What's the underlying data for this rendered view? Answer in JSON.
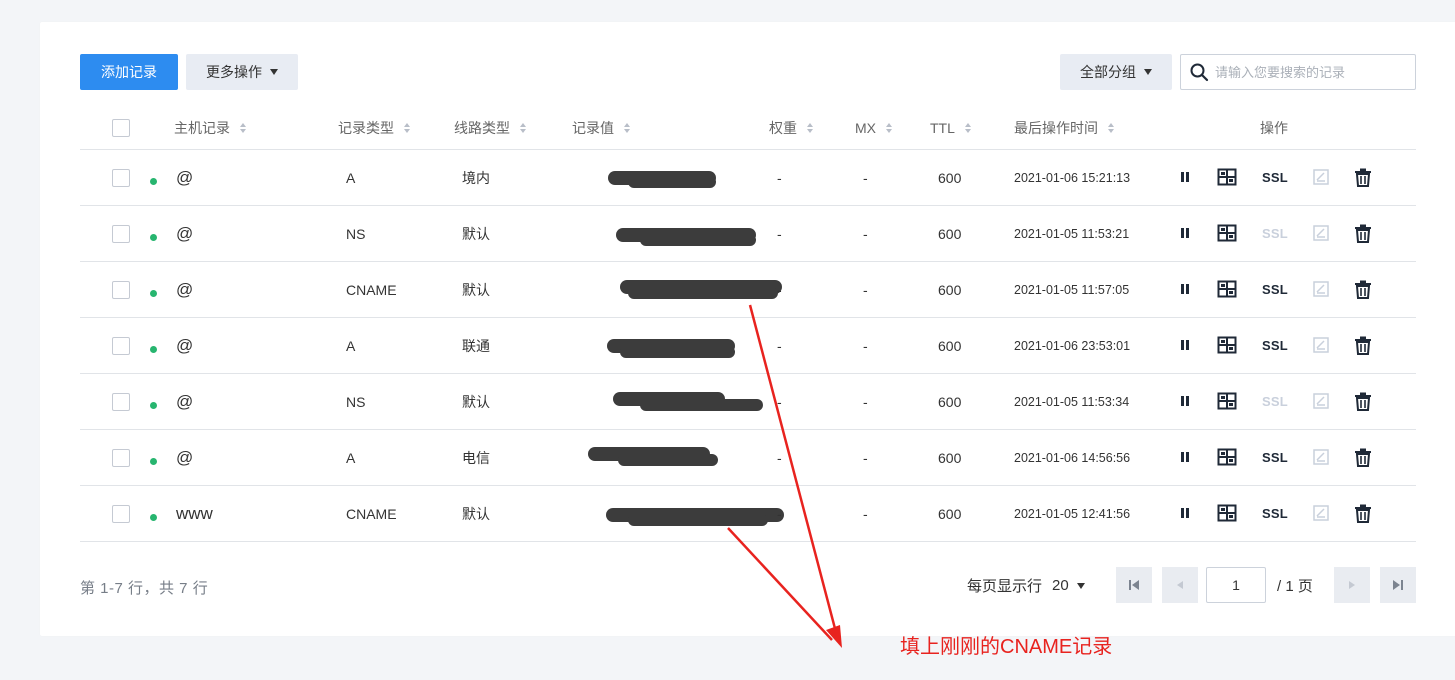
{
  "toolbar": {
    "add_label": "添加记录",
    "more_label": "更多操作",
    "group_label": "全部分组",
    "search_placeholder": "请输入您要搜索的记录"
  },
  "table": {
    "columns": {
      "host": "主机记录",
      "type": "记录类型",
      "line": "线路类型",
      "value": "记录值",
      "weight": "权重",
      "mx": "MX",
      "ttl": "TTL",
      "time": "最后操作时间",
      "ops": "操作"
    },
    "rows": [
      {
        "host": "@",
        "type": "A",
        "line": "境内",
        "weight": "-",
        "mx": "-",
        "ttl": "600",
        "time": "2021-01-06 15:21:13",
        "ssl_enabled": true
      },
      {
        "host": "@",
        "type": "NS",
        "line": "默认",
        "weight": "-",
        "mx": "-",
        "ttl": "600",
        "time": "2021-01-05 11:53:21",
        "ssl_enabled": false
      },
      {
        "host": "@",
        "type": "CNAME",
        "line": "默认",
        "weight": "-",
        "mx": "-",
        "ttl": "600",
        "time": "2021-01-05 11:57:05",
        "ssl_enabled": true
      },
      {
        "host": "@",
        "type": "A",
        "line": "联通",
        "weight": "-",
        "mx": "-",
        "ttl": "600",
        "time": "2021-01-06 23:53:01",
        "ssl_enabled": true
      },
      {
        "host": "@",
        "type": "NS",
        "line": "默认",
        "weight": "-",
        "mx": "-",
        "ttl": "600",
        "time": "2021-01-05 11:53:34",
        "ssl_enabled": false
      },
      {
        "host": "@",
        "type": "A",
        "line": "电信",
        "weight": "-",
        "mx": "-",
        "ttl": "600",
        "time": "2021-01-06 14:56:56",
        "ssl_enabled": true
      },
      {
        "host": "www",
        "type": "CNAME",
        "line": "默认",
        "weight": "-",
        "mx": "-",
        "ttl": "600",
        "time": "2021-01-05 12:41:56",
        "ssl_enabled": true
      }
    ],
    "ssl_label": "SSL"
  },
  "footer": {
    "summary": "第 1-7 行，共 7 行",
    "per_page_label": "每页显示行",
    "per_page_value": "20",
    "page_value": "1",
    "page_total": "/ 1 页"
  },
  "annotation": {
    "text": "填上刚刚的CNAME记录",
    "color": "#e8231f"
  },
  "colors": {
    "primary": "#2d8cf0",
    "status_dot": "#27b56f"
  }
}
